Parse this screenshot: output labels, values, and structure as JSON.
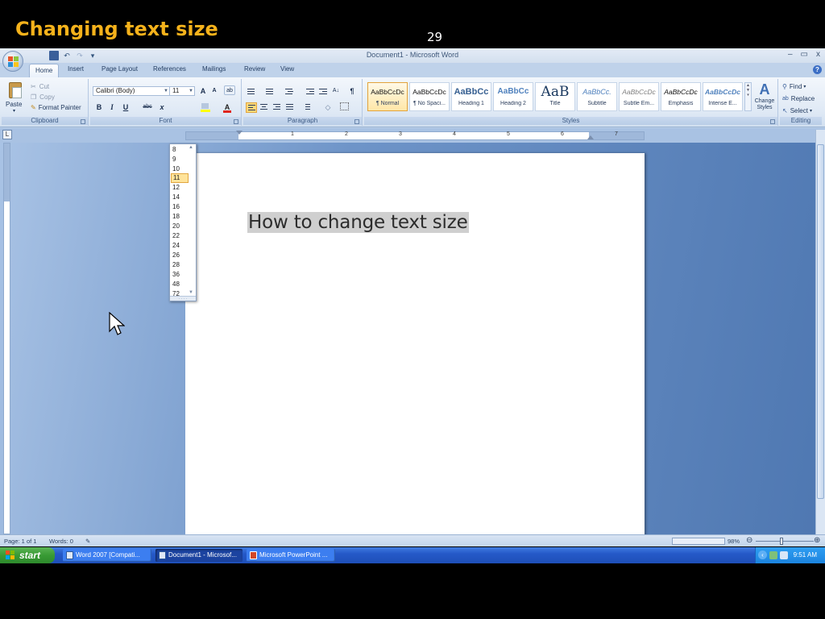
{
  "slide": {
    "title": "Changing text size",
    "number": "29"
  },
  "window": {
    "title": "Document1 - Microsoft Word",
    "minimize": "–",
    "restore": "▭",
    "close": "x"
  },
  "qat": {
    "save": "save-icon",
    "undo": "undo-icon",
    "redo": "redo-icon",
    "customize": "▾"
  },
  "tabs": [
    "Home",
    "Insert",
    "Page Layout",
    "References",
    "Mailings",
    "Review",
    "View"
  ],
  "help": "?",
  "clipboard": {
    "group": "Clipboard",
    "paste": "Paste",
    "cut": "Cut",
    "copy": "Copy",
    "format_painter": "Format Painter"
  },
  "font": {
    "group": "Font",
    "name": "Calibri (Body)",
    "size": "11",
    "grow": "A",
    "shrink": "A",
    "bold": "B",
    "italic": "I",
    "underline": "U",
    "strike": "abc",
    "subscript": "x"
  },
  "paragraph": {
    "group": "Paragraph",
    "show_marks": "¶"
  },
  "styles": {
    "group": "Styles",
    "items": [
      {
        "sample": "AaBbCcDc",
        "name": "¶ Normal"
      },
      {
        "sample": "AaBbCcDc",
        "name": "¶ No Spaci..."
      },
      {
        "sample": "AaBbCc",
        "name": "Heading 1"
      },
      {
        "sample": "AaBbCc",
        "name": "Heading 2"
      },
      {
        "sample": "AaB",
        "name": "Title"
      },
      {
        "sample": "AaBbCc.",
        "name": "Subtitle"
      },
      {
        "sample": "AaBbCcDc",
        "name": "Subtle Em..."
      },
      {
        "sample": "AaBbCcDc",
        "name": "Emphasis"
      },
      {
        "sample": "AaBbCcDc",
        "name": "Intense E..."
      }
    ],
    "change_styles": "Change Styles"
  },
  "editing": {
    "group": "Editing",
    "find": "Find",
    "replace": "Replace",
    "select": "Select"
  },
  "size_options": [
    "8",
    "9",
    "10",
    "11",
    "12",
    "14",
    "16",
    "18",
    "20",
    "22",
    "24",
    "26",
    "28",
    "36",
    "48",
    "72"
  ],
  "size_selected": "11",
  "ruler_numbers": [
    "1",
    "2",
    "3",
    "4",
    "5",
    "6",
    "7"
  ],
  "document": {
    "text": "How to change text size"
  },
  "status": {
    "page": "Page: 1 of 1",
    "words": "Words: 0",
    "zoom": "98%"
  },
  "taskbar": {
    "start": "start",
    "tasks": [
      {
        "label": "Word 2007 [Compati..."
      },
      {
        "label": "Document1 - Microsof..."
      },
      {
        "label": "Microsoft PowerPoint ..."
      }
    ],
    "clock": "9:51 AM"
  },
  "colors": {
    "accent": "#f5b21b",
    "word_blue": "#2b579a",
    "taskbar": "#245edb",
    "start_green": "#3c9a35",
    "selection": "#cfcfcf"
  }
}
